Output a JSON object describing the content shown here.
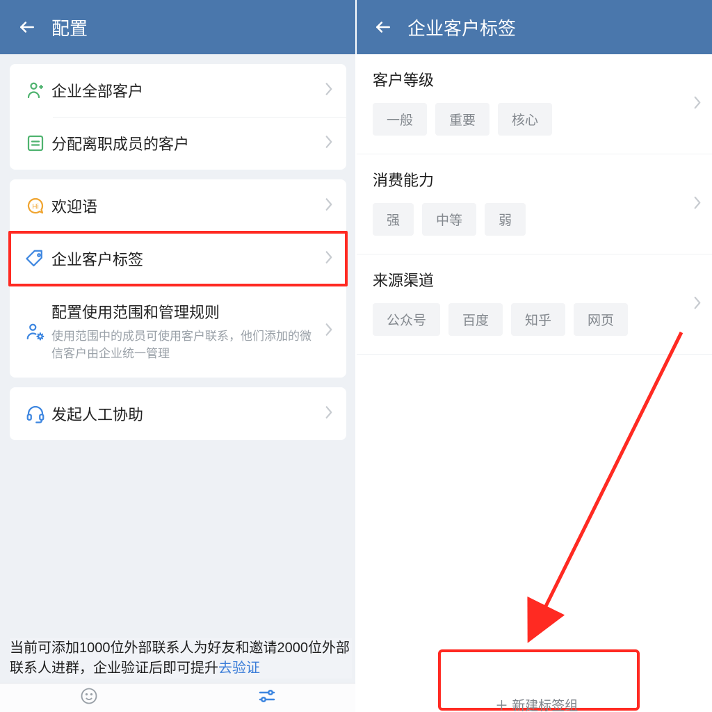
{
  "left": {
    "header_title": "配置",
    "groups": [
      {
        "rows": [
          {
            "icon": "person-icon",
            "icon_color": "#4fb36f",
            "label": "企业全部客户"
          },
          {
            "icon": "list-icon",
            "icon_color": "#4fb36f",
            "label": "分配离职成员的客户"
          }
        ]
      },
      {
        "rows": [
          {
            "icon": "chat-hi-icon",
            "icon_color": "#f0a531",
            "label": "欢迎语"
          },
          {
            "icon": "tag-icon",
            "icon_color": "#3d86e0",
            "label": "企业客户标签",
            "highlight": true
          },
          {
            "icon": "person-gear-icon",
            "icon_color": "#3d86e0",
            "label": "配置使用范围和管理规则",
            "sub": "使用范围中的成员可使用客户联系，他们添加的微信客户由企业统一管理"
          }
        ]
      },
      {
        "rows": [
          {
            "icon": "headset-icon",
            "icon_color": "#3d86e0",
            "label": "发起人工协助"
          }
        ]
      }
    ],
    "footer_text_a": "当前可添加1000位外部联系人为好友和邀请2000位外部联系人进群，企业验证后即可提升",
    "footer_link": "去验证"
  },
  "right": {
    "header_title": "企业客户标签",
    "sections": [
      {
        "title": "客户等级",
        "tags": [
          "一般",
          "重要",
          "核心"
        ]
      },
      {
        "title": "消费能力",
        "tags": [
          "强",
          "中等",
          "弱"
        ]
      },
      {
        "title": "来源渠道",
        "tags": [
          "公众号",
          "百度",
          "知乎",
          "网页"
        ]
      }
    ],
    "add_hint": "＋ 新建标签组"
  },
  "colors": {
    "header_bg": "#4a77ac",
    "highlight": "#ff2a22"
  }
}
